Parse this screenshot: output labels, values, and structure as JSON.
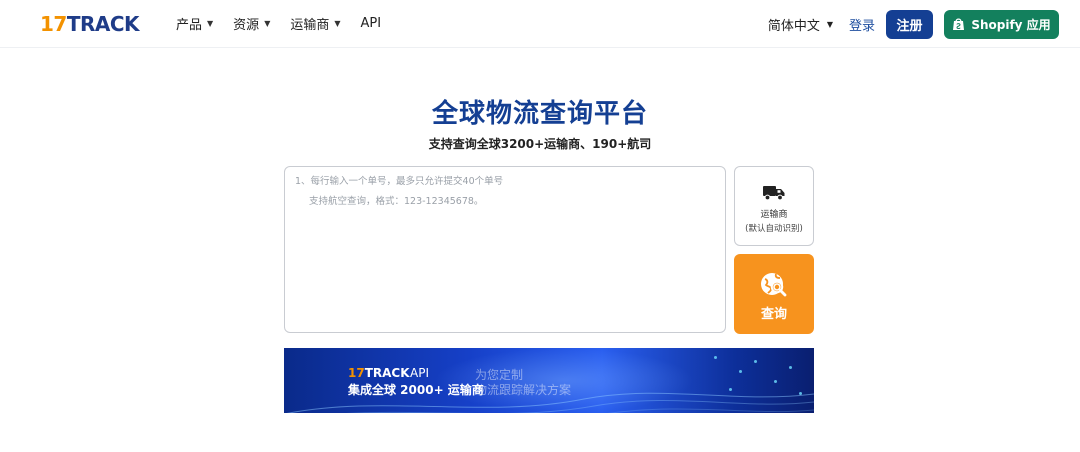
{
  "header": {
    "logo_num": "17",
    "logo_word": "TRACK",
    "nav": [
      {
        "label": "产品"
      },
      {
        "label": "资源"
      },
      {
        "label": "运输商"
      },
      {
        "label": "API"
      }
    ],
    "language": "简体中文",
    "login": "登录",
    "register": "注册",
    "shopify": "Shopify 应用"
  },
  "hero": {
    "title": "全球物流查询平台",
    "subtitle": "支持查询全球3200+运输商、190+航司"
  },
  "tracking": {
    "placeholder_line1": "1、每行输入一个单号，最多只允许提交40个单号",
    "placeholder_line2": "支持航空查询，格式：123-12345678。",
    "value": ""
  },
  "carrier_button": {
    "label": "运输商",
    "sublabel": "(默认自动识别)"
  },
  "query_button": {
    "label": "查询"
  },
  "banner": {
    "logo_num": "17",
    "logo_word": "TRACK",
    "api": "API",
    "line1": "集成全球 2000+ 运输商",
    "sub1": "为您定制",
    "sub2": "物流跟踪解决方案"
  },
  "colors": {
    "brand_blue": "#143f93",
    "brand_orange": "#f39200",
    "shopify_green": "#13805d",
    "query_orange": "#f7931e"
  },
  "icons": {
    "carrier": "truck-icon",
    "query": "globe-search-icon",
    "shopify": "shopping-bag-icon",
    "dropdown": "caret-down-icon"
  }
}
